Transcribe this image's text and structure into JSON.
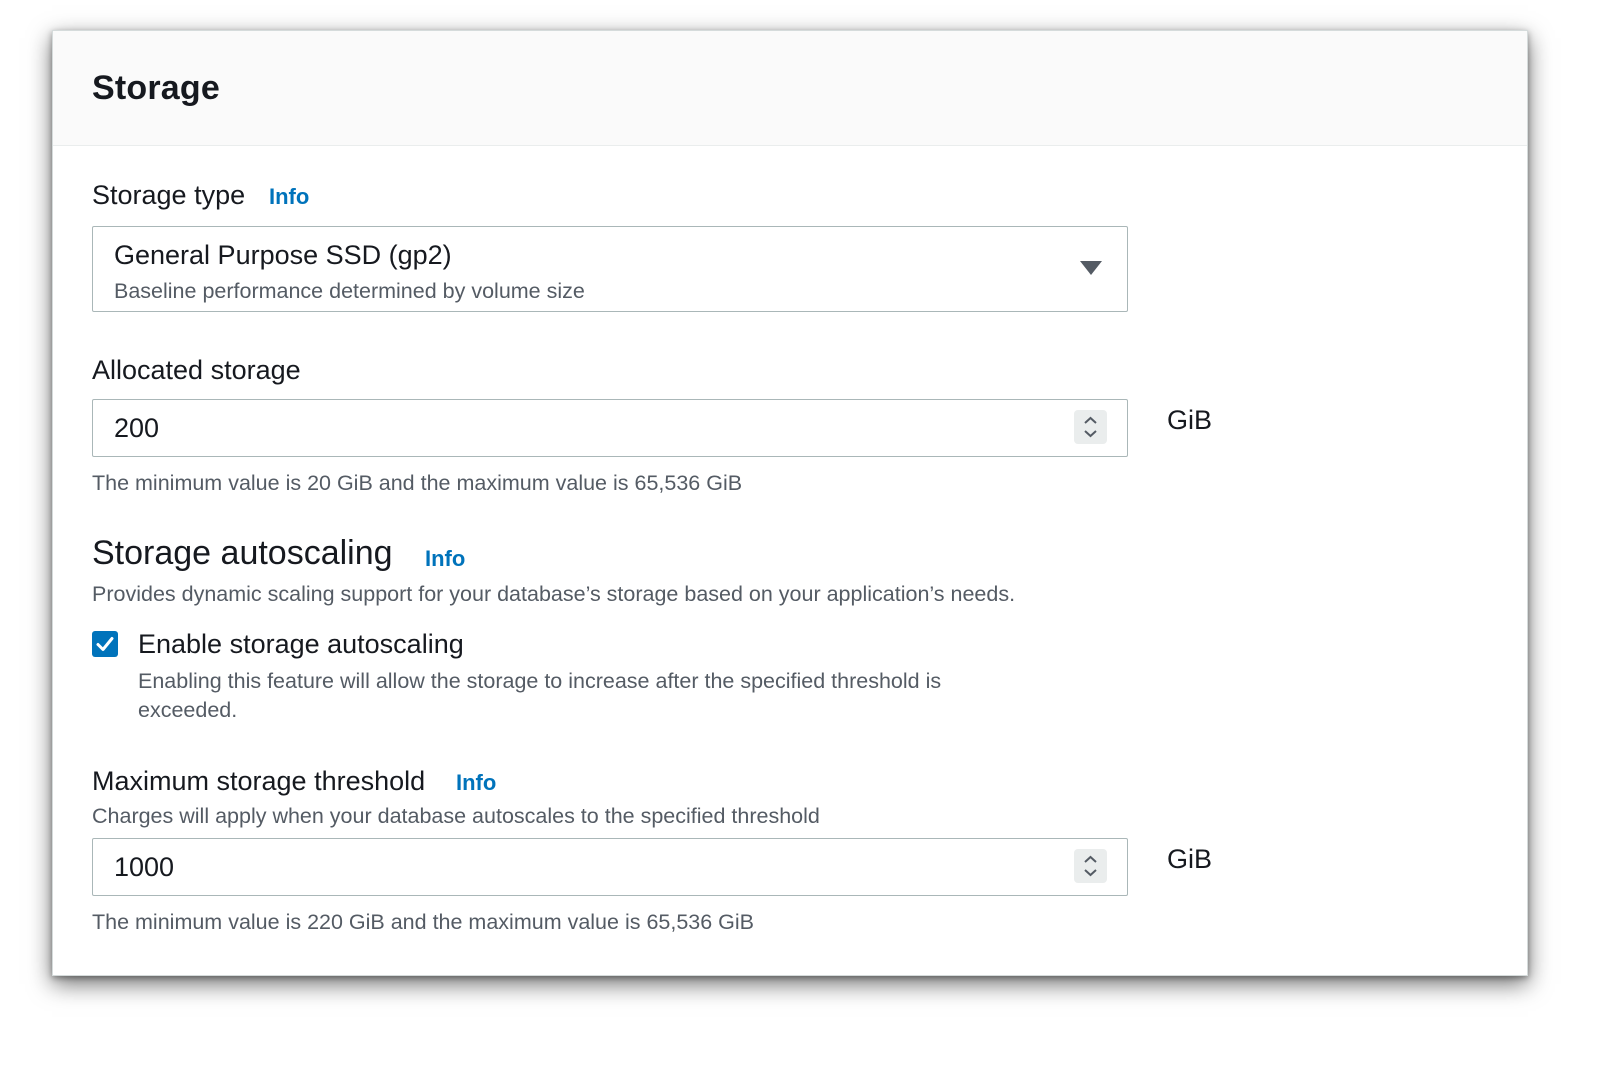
{
  "panel": {
    "title": "Storage"
  },
  "storage_type": {
    "label": "Storage type",
    "info": "Info",
    "selected_value": "General Purpose SSD (gp2)",
    "selected_description": "Baseline performance determined by volume size",
    "icon": "caret-down-icon"
  },
  "allocated_storage": {
    "label": "Allocated storage",
    "value": "200",
    "unit": "GiB",
    "constraint": "The minimum value is 20 GiB and the maximum value is 65,536 GiB",
    "icon": "stepper-icon"
  },
  "autoscaling": {
    "heading": "Storage autoscaling",
    "info": "Info",
    "description": "Provides dynamic scaling support for your database’s storage based on your application’s needs.",
    "checkbox_label": "Enable storage autoscaling",
    "checkbox_checked": true,
    "checkbox_description_line1": "Enabling this feature will allow the storage to increase after the specified threshold is",
    "checkbox_description_line2": "exceeded."
  },
  "max_threshold": {
    "label": "Maximum storage threshold",
    "info": "Info",
    "description": "Charges will apply when your database autoscales to the specified threshold",
    "value": "1000",
    "unit": "GiB",
    "constraint": "The minimum value is 220 GiB and the maximum value is 65,536 GiB",
    "icon": "stepper-icon"
  },
  "colors": {
    "link": "#0073bb",
    "checkbox": "#0073bb",
    "text": "#16191f",
    "secondary_text": "#545b64",
    "border": "#aab7b8"
  }
}
